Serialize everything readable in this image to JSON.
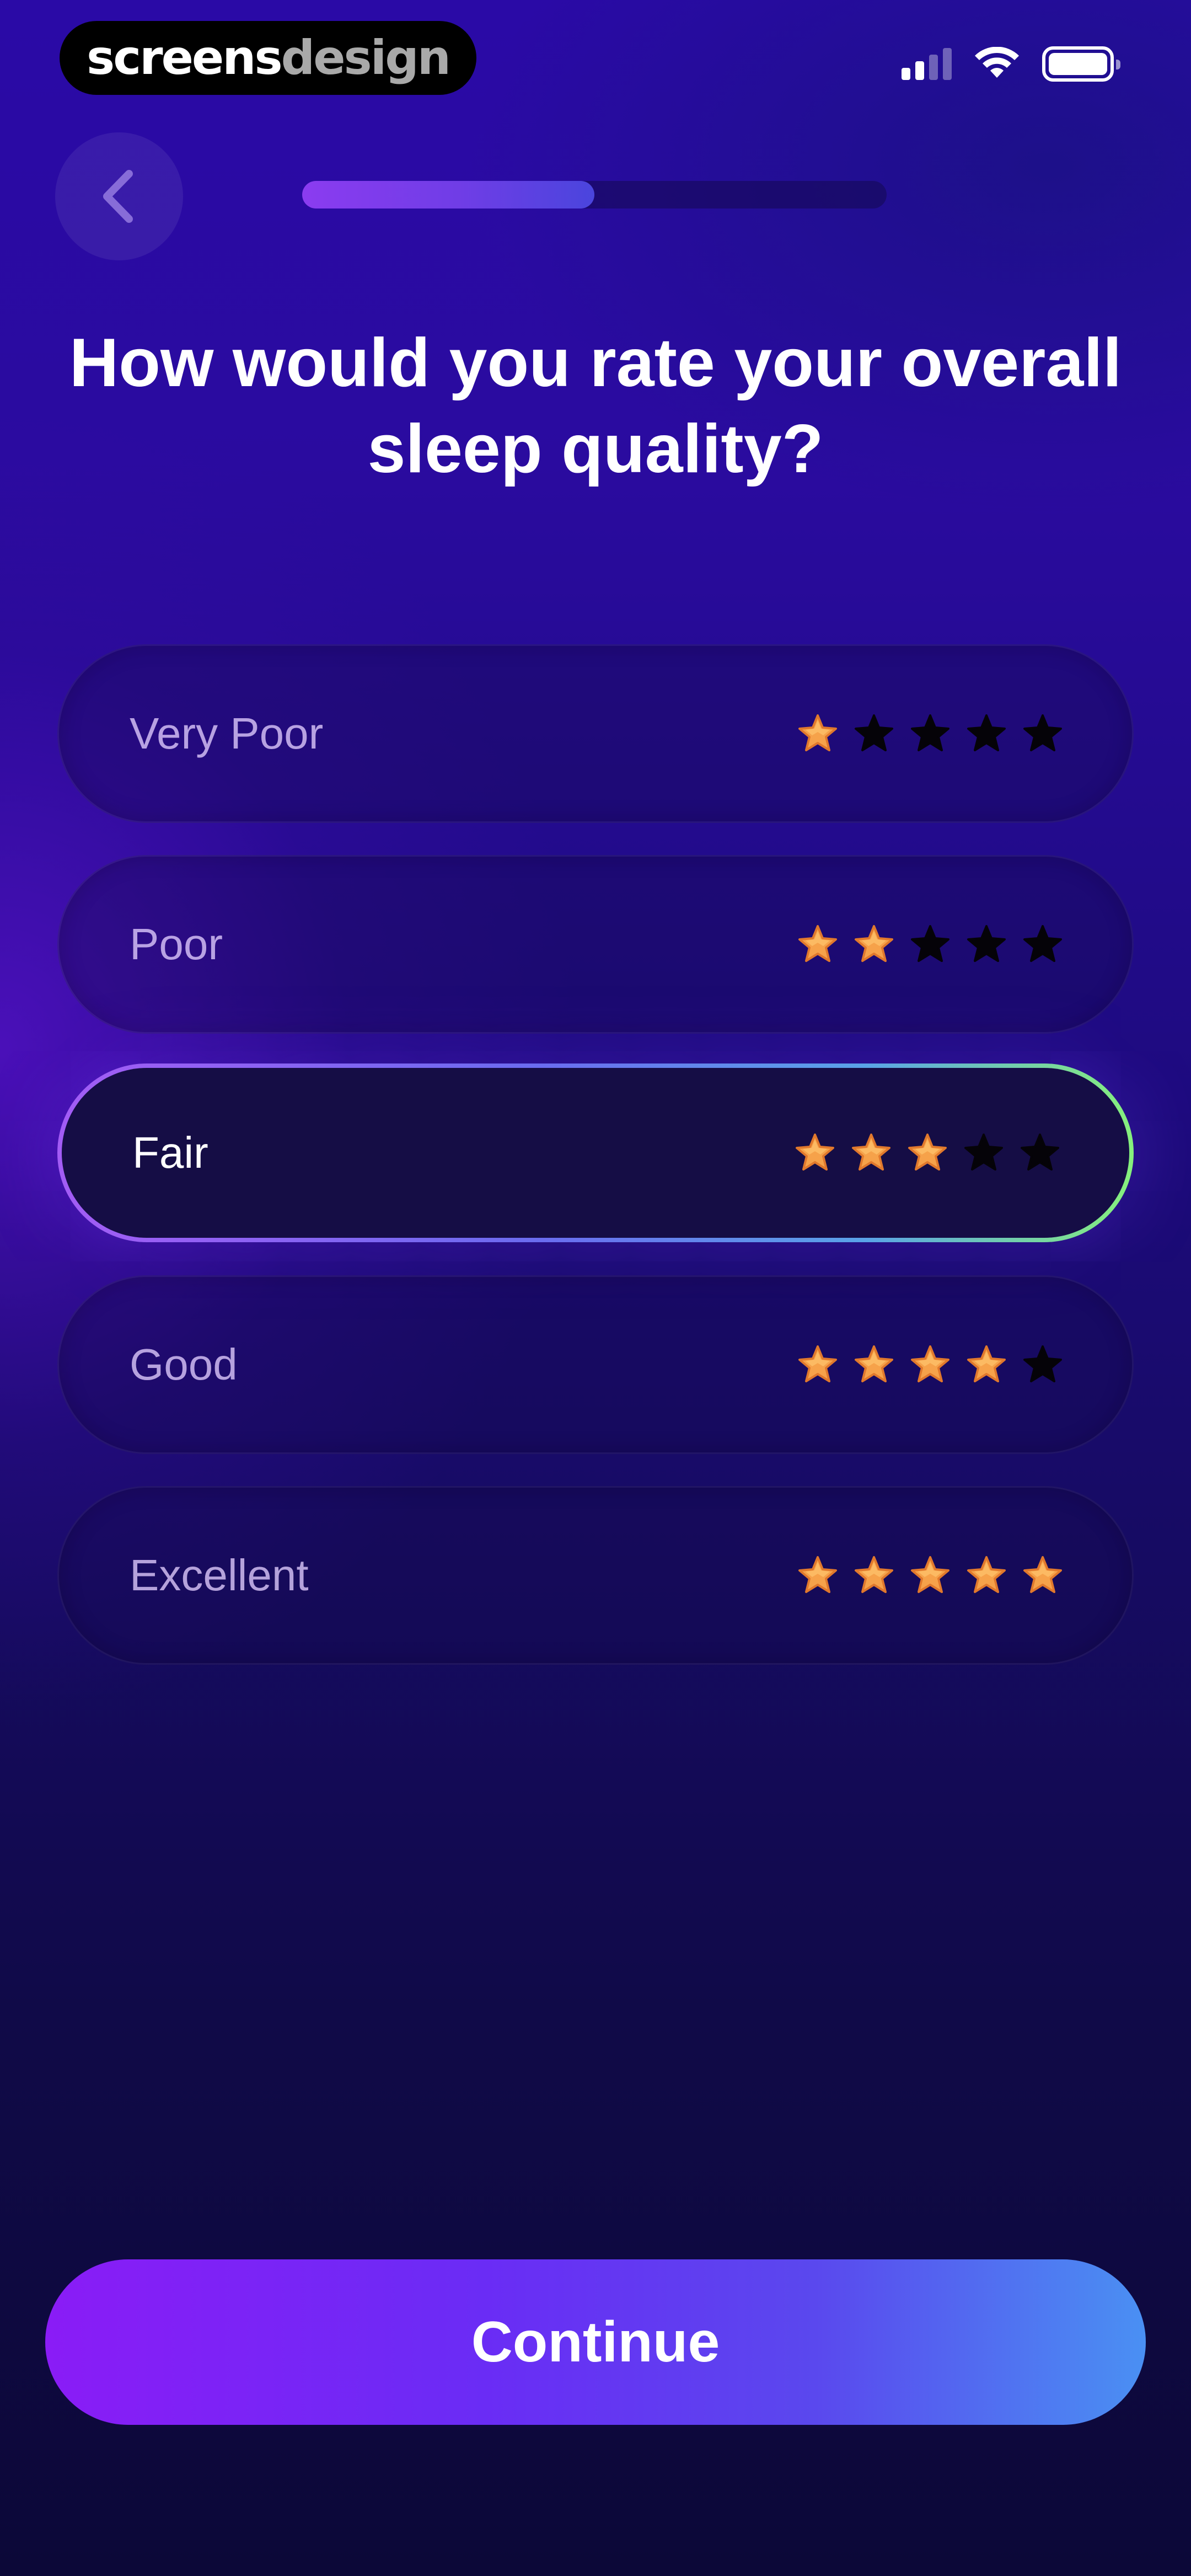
{
  "watermark": {
    "part1": "screens",
    "part2": "design"
  },
  "status_bar": {
    "signal_icon": "cellular-signal-icon",
    "wifi_icon": "wifi-icon",
    "battery_icon": "battery-icon"
  },
  "nav": {
    "back_icon": "chevron-left-icon"
  },
  "progress": {
    "value": 0.5
  },
  "question": {
    "title": "How would you rate your overall sleep quality?"
  },
  "options": [
    {
      "label": "Very Poor",
      "stars": 1,
      "selected": false
    },
    {
      "label": "Poor",
      "stars": 2,
      "selected": false
    },
    {
      "label": "Fair",
      "stars": 3,
      "selected": true
    },
    {
      "label": "Good",
      "stars": 4,
      "selected": false
    },
    {
      "label": "Excellent",
      "stars": 5,
      "selected": false
    }
  ],
  "max_stars": 5,
  "colors": {
    "star_filled": "#f6a24a",
    "star_empty": "#050308",
    "accent_start": "#8a1cf6",
    "accent_end": "#4a90f3",
    "selected_border_end": "#86f07c"
  },
  "footer": {
    "continue_label": "Continue"
  }
}
